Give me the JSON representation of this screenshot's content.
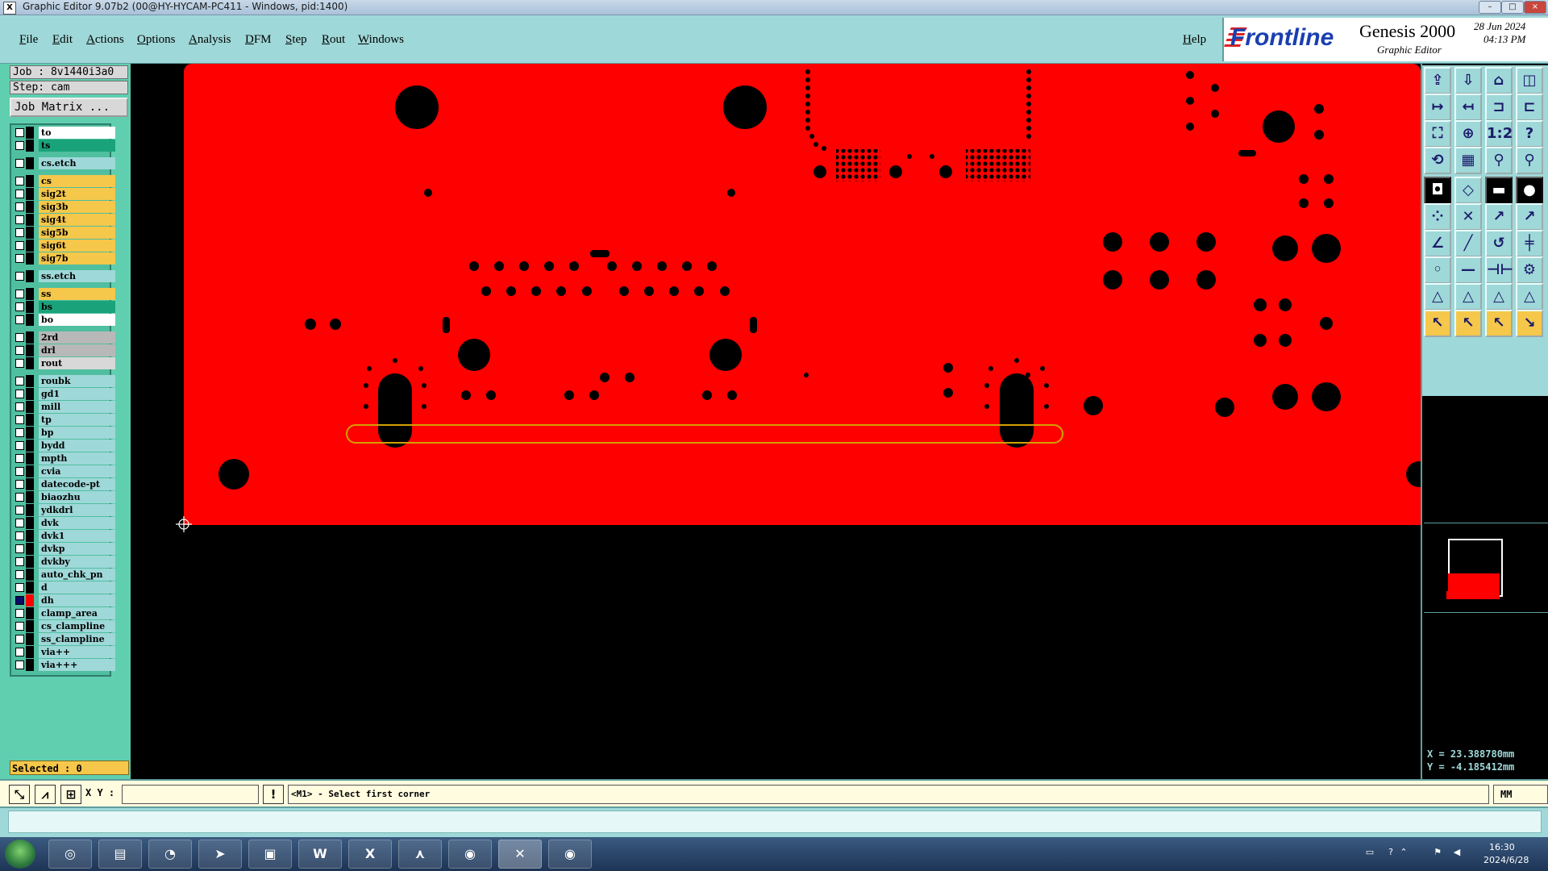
{
  "window": {
    "title": "Graphic Editor 9.07b2 (00@HY-HYCAM-PC411 - Windows, pid:1400)",
    "app_icon": "X"
  },
  "menu": [
    "File",
    "Edit",
    "Actions",
    "Options",
    "Analysis",
    "DFM",
    "Step",
    "Rout",
    "Windows",
    "Help"
  ],
  "brand": {
    "frontline": "Frontline",
    "product": "Genesis 2000",
    "subtitle": "Graphic Editor",
    "date": "28 Jun 2024",
    "time": "04:13 PM"
  },
  "job": {
    "job_label": "Job : 8v1440i3a0",
    "step_label": "Step: cam",
    "matrix_button": "Job Matrix ..."
  },
  "layers": [
    {
      "name": "to",
      "color": "#ffffff",
      "checked": false
    },
    {
      "name": "ts",
      "color": "#1aa37a",
      "checked": false
    },
    {
      "name": "cs.etch",
      "color": "#9fd8d8",
      "checked": false
    },
    {
      "name": "cs",
      "color": "#f5c74a",
      "checked": false
    },
    {
      "name": "sig2t",
      "color": "#f5c74a",
      "checked": false
    },
    {
      "name": "sig3b",
      "color": "#f5c74a",
      "checked": false
    },
    {
      "name": "sig4t",
      "color": "#f5c74a",
      "checked": false
    },
    {
      "name": "sig5b",
      "color": "#f5c74a",
      "checked": false
    },
    {
      "name": "sig6t",
      "color": "#f5c74a",
      "checked": false
    },
    {
      "name": "sig7b",
      "color": "#f5c74a",
      "checked": false
    },
    {
      "name": "ss.etch",
      "color": "#9fd8d8",
      "checked": false
    },
    {
      "name": "ss",
      "color": "#f5c74a",
      "checked": false
    },
    {
      "name": "bs",
      "color": "#1aa37a",
      "checked": false
    },
    {
      "name": "bo",
      "color": "#ffffff",
      "checked": false
    },
    {
      "name": "2rd",
      "color": "#b8b8b8",
      "checked": false
    },
    {
      "name": "drl",
      "color": "#b8b8b8",
      "checked": false
    },
    {
      "name": "rout",
      "color": "#d8d8d8",
      "checked": false
    },
    {
      "name": "roubk",
      "color": "#9fd8d8",
      "checked": false
    },
    {
      "name": "gd1",
      "color": "#9fd8d8",
      "checked": false
    },
    {
      "name": "mill",
      "color": "#9fd8d8",
      "checked": false
    },
    {
      "name": "tp",
      "color": "#9fd8d8",
      "checked": false
    },
    {
      "name": "bp",
      "color": "#9fd8d8",
      "checked": false
    },
    {
      "name": "bydd",
      "color": "#9fd8d8",
      "checked": false
    },
    {
      "name": "mpth",
      "color": "#9fd8d8",
      "checked": false
    },
    {
      "name": "cvia",
      "color": "#9fd8d8",
      "checked": false
    },
    {
      "name": "datecode-pt",
      "color": "#9fd8d8",
      "checked": false
    },
    {
      "name": "biaozhu",
      "color": "#9fd8d8",
      "checked": false
    },
    {
      "name": "ydkdrl",
      "color": "#9fd8d8",
      "checked": false
    },
    {
      "name": "dvk",
      "color": "#9fd8d8",
      "checked": false
    },
    {
      "name": "dvk1",
      "color": "#9fd8d8",
      "checked": false
    },
    {
      "name": "dvkp",
      "color": "#9fd8d8",
      "checked": false
    },
    {
      "name": "dvkby",
      "color": "#9fd8d8",
      "checked": false
    },
    {
      "name": "auto_chk_pn",
      "color": "#9fd8d8",
      "checked": false
    },
    {
      "name": "d",
      "color": "#9fd8d8",
      "checked": false
    },
    {
      "name": "dh",
      "color": "#9fd8d8",
      "checked": true
    },
    {
      "name": "clamp_area",
      "color": "#9fd8d8",
      "checked": false
    },
    {
      "name": "cs_clampline",
      "color": "#9fd8d8",
      "checked": false
    },
    {
      "name": "ss_clampline",
      "color": "#9fd8d8",
      "checked": false
    },
    {
      "name": "via++",
      "color": "#9fd8d8",
      "checked": false
    },
    {
      "name": "via+++",
      "color": "#9fd8d8",
      "checked": false
    }
  ],
  "selected_label": "Selected : 0",
  "coords": {
    "x": "X = 23.388780mm",
    "y": "Y = -4.185412mm"
  },
  "command": {
    "xy_label": "X Y :",
    "xy_value": "",
    "info_button": "!",
    "prompt": "<M1> - Select first corner",
    "units": "MM"
  },
  "taskbar": {
    "time": "16:30",
    "date": "2024/6/28"
  },
  "colors": {
    "board": "#ff0000",
    "outline": "#d4a000",
    "panel": "#5fcfb0",
    "menubar": "#9fd8d8"
  }
}
